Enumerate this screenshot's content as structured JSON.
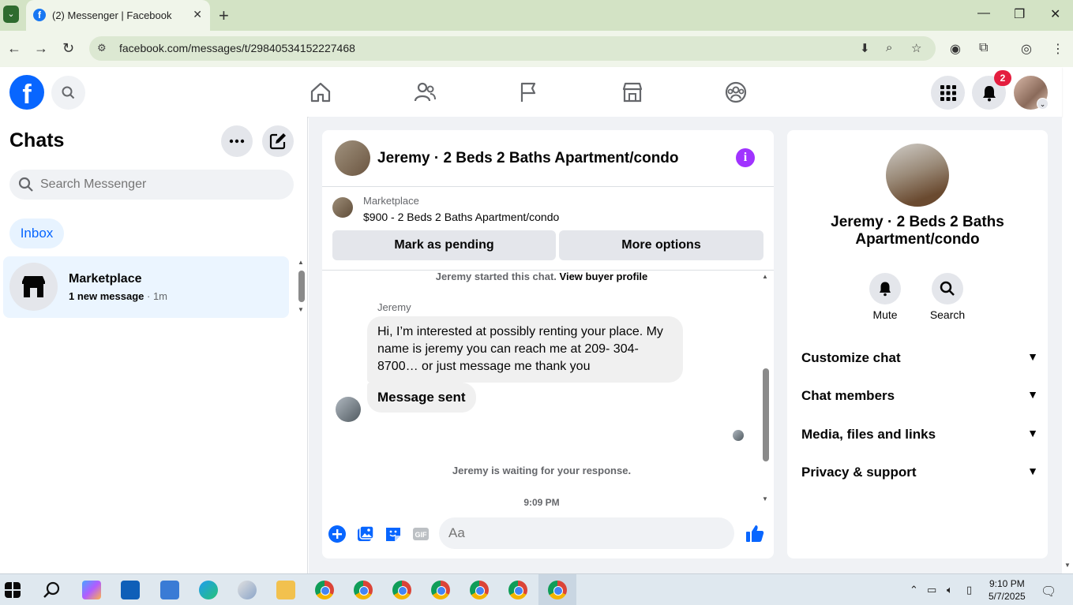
{
  "browser": {
    "tab_title": "(2) Messenger | Facebook",
    "url": "facebook.com/messages/t/29840534152227468"
  },
  "header": {
    "notification_count": "2"
  },
  "left_panel": {
    "title": "Chats",
    "search_placeholder": "Search Messenger",
    "filter_label": "Inbox",
    "chats": [
      {
        "name": "Marketplace",
        "preview": "1 new message",
        "time": "· 1m"
      }
    ]
  },
  "conversation": {
    "title": "Jeremy · 2 Beds 2 Baths Apartment/condo",
    "listing_label": "Marketplace",
    "listing_price_title": "$900 - 2 Beds 2 Baths Apartment/condo",
    "mark_pending_label": "Mark as pending",
    "more_options_label": "More options",
    "started_text": "Jeremy started this chat.",
    "view_profile_link": "View buyer profile",
    "sender_name": "Jeremy",
    "message_1": "Hi, I’m interested at possibly renting your place. My name is jeremy you can reach me at 209- 304-8700… or just message me thank you",
    "message_2": "Message sent",
    "waiting_text": "Jeremy is waiting for your response.",
    "timestamp": "9:09 PM",
    "input_placeholder": "Aa"
  },
  "right_panel": {
    "name": "Jeremy · 2 Beds 2 Baths Apartment/condo",
    "mute_label": "Mute",
    "search_label": "Search",
    "sections": [
      {
        "label": "Customize chat"
      },
      {
        "label": "Chat members"
      },
      {
        "label": "Media, files and links"
      },
      {
        "label": "Privacy & support"
      }
    ]
  },
  "taskbar": {
    "time": "9:10 PM",
    "date": "5/7/2025"
  },
  "colors": {
    "fb_blue": "#0866ff",
    "accent_purple": "#a033ff",
    "badge_red": "#e41e3f"
  }
}
